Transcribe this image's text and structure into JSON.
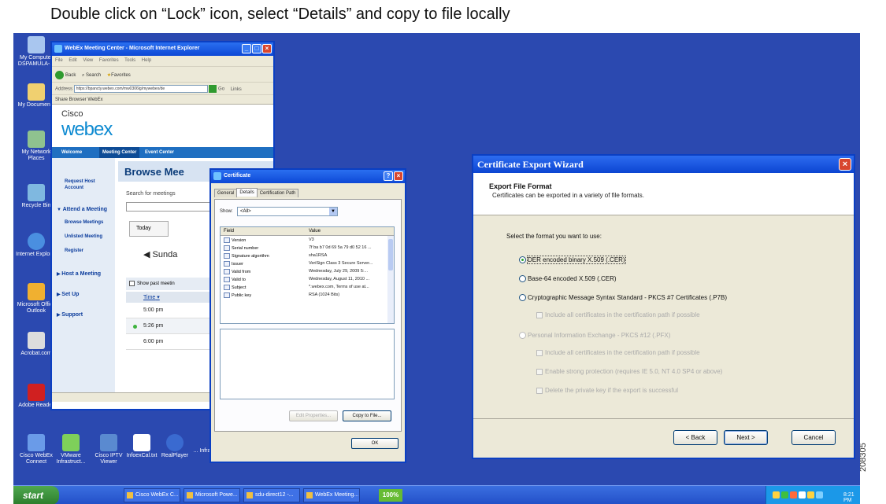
{
  "caption": "Double click on “Lock” icon, select “Details” and copy to file locally",
  "figure_id": "208305",
  "desktop": {
    "icons": [
      {
        "label": "My Computer DSPAMULA-...",
        "color": "#a9c6ef"
      },
      {
        "label": "My Documents",
        "color": "#f0d070"
      },
      {
        "label": "My Network Places",
        "color": "#8fc28f"
      },
      {
        "label": "Recycle Bin",
        "color": "#7fb8e0"
      },
      {
        "label": "Internet Explorer",
        "color": "#4a8fe0"
      },
      {
        "label": "Microsoft Office Outlook",
        "color": "#f0b030"
      },
      {
        "label": "Acrobat.com",
        "color": "#dddddd"
      },
      {
        "label": "Adobe Reader",
        "color": "#d02020"
      },
      {
        "label": "Cisco WebEx Connect",
        "color": "#6a9be8"
      },
      {
        "label": "VMware Infrastruct...",
        "color": "#7ed05a"
      },
      {
        "label": "Cisco IPTV Viewer",
        "color": "#5a8ad0"
      },
      {
        "label": "InfoexCal.txt",
        "color": "#ffffff"
      },
      {
        "label": "RealPlayer",
        "color": "#3a6ad0"
      },
      {
        "label": "... Infrastruct...",
        "color": "#cccccc"
      }
    ],
    "taskbar": {
      "start": "start",
      "items": [
        "Cisco WebEx C...",
        "Microsoft Powe...",
        "sdu-direct12 -...",
        "WebEx Meeting..."
      ],
      "zoom": "100%",
      "clock": "8:21 PM"
    }
  },
  "ie": {
    "title": "WebEx Meeting Center - Microsoft Internet Explorer",
    "menu": "File Edit View Favorites Tools Help",
    "toolbar": {
      "back": "Back",
      "search": "Search",
      "favorites": "Favorites"
    },
    "address_label": "Address",
    "address_value": "https://bpancty.webex.com/mw0306lg/mywebex/de",
    "go": "Go",
    "links": "Links",
    "fav_bar": "Share Browser   WebEx",
    "logo_small": "Cisco",
    "logo": "webex",
    "nav": [
      "Welcome",
      "Meeting Center",
      "Event Center"
    ],
    "left_links": {
      "request": "Request Host Account",
      "attend": "Attend a Meeting",
      "browse": "Browse Meetings",
      "unlisted": "Unlisted Meeting",
      "register": "Register",
      "host": "Host a Meeting",
      "setup": "Set Up",
      "support": "Support"
    },
    "main": {
      "heading": "Browse Mee",
      "search_label": "Search for meetings",
      "tab_today": "Today",
      "day": "Sunda",
      "past": "Show past meetin",
      "time_header": "Time",
      "times": [
        "5:00 pm",
        "5:26 pm",
        "6:00 pm"
      ]
    }
  },
  "certificate": {
    "title": "Certificate",
    "tabs": [
      "General",
      "Details",
      "Certification Path"
    ],
    "show_label": "Show:",
    "show_value": "<All>",
    "col_field": "Field",
    "col_value": "Value",
    "rows": [
      {
        "field": "Version",
        "value": "V3"
      },
      {
        "field": "Serial number",
        "value": "7f ba b7 0d 69 5a 79 d0 52 16 ..."
      },
      {
        "field": "Signature algorithm",
        "value": "sha1RSA"
      },
      {
        "field": "Issuer",
        "value": "VeriSign Class 3 Secure Server..."
      },
      {
        "field": "Valid from",
        "value": "Wednesday, July 29, 2009 5:..."
      },
      {
        "field": "Valid to",
        "value": "Wednesday, August 11, 2010 ..."
      },
      {
        "field": "Subject",
        "value": "*.webex.com, Terms of use at..."
      },
      {
        "field": "Public key",
        "value": "RSA (1024 Bits)"
      }
    ],
    "edit_props": "Edit Properties...",
    "copy_to_file": "Copy to File...",
    "ok": "OK"
  },
  "wizard": {
    "title": "Certificate Export Wizard",
    "heading": "Export File Format",
    "subheading": "Certificates can be exported in a variety of file formats.",
    "prompt": "Select the format you want to use:",
    "options": {
      "der": "DER encoded binary X.509 (.CER)",
      "base64": "Base-64 encoded X.509 (.CER)",
      "pkcs7": "Cryptographic Message Syntax Standard - PKCS #7 Certificates (.P7B)",
      "pkcs7_include": "Include all certificates in the certification path if possible",
      "pfx": "Personal Information Exchange - PKCS #12 (.PFX)",
      "pfx_include": "Include all certificates in the certification path if possible",
      "pfx_strong": "Enable strong protection (requires IE 5.0, NT 4.0 SP4 or above)",
      "pfx_delete": "Delete the private key if the export is successful"
    },
    "selected": "der",
    "back": "< Back",
    "next": "Next >",
    "cancel": "Cancel"
  }
}
